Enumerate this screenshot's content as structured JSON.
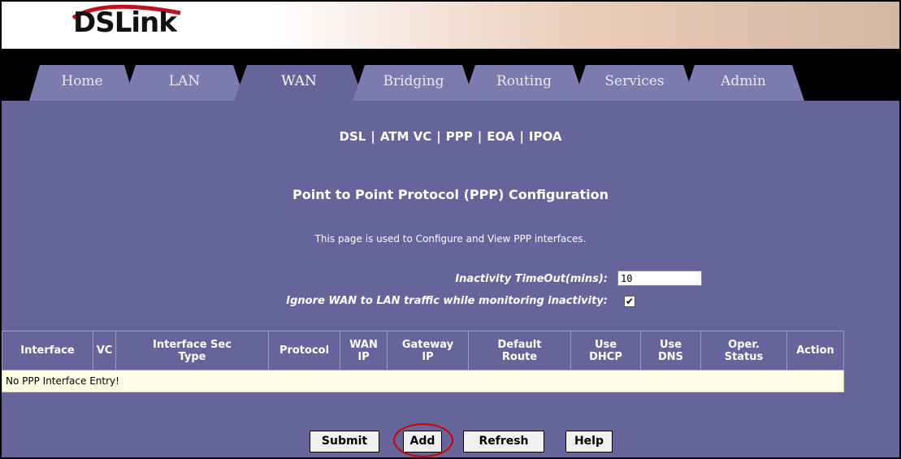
{
  "brand": {
    "logo_text": "DSLink"
  },
  "tabs": [
    {
      "label": "Home"
    },
    {
      "label": "LAN"
    },
    {
      "label": "WAN",
      "active": true
    },
    {
      "label": "Bridging"
    },
    {
      "label": "Routing"
    },
    {
      "label": "Services"
    },
    {
      "label": "Admin"
    }
  ],
  "subnav": {
    "items": [
      "DSL",
      "ATM VC",
      "PPP",
      "EOA",
      "IPOA"
    ],
    "separator": "|"
  },
  "page": {
    "title": "Point to Point Protocol (PPP) Configuration",
    "description": "This page is used to Configure and View PPP interfaces."
  },
  "form": {
    "inactivity_label": "Inactivity TimeOut(mins):",
    "inactivity_value": "10",
    "ignore_label": "Ignore WAN to LAN traffic while monitoring inactivity:",
    "ignore_checked": true
  },
  "table": {
    "columns": [
      [
        "Interface"
      ],
      [
        "VC"
      ],
      [
        "Interface Sec",
        "Type"
      ],
      [
        "Protocol"
      ],
      [
        "WAN",
        "IP"
      ],
      [
        "Gateway",
        "IP"
      ],
      [
        "Default",
        "Route"
      ],
      [
        "Use",
        "DHCP"
      ],
      [
        "Use",
        "DNS"
      ],
      [
        "Oper.",
        "Status"
      ],
      [
        "Action"
      ]
    ],
    "empty_message": "No PPP Interface Entry!"
  },
  "buttons": {
    "submit": "Submit",
    "add": "Add",
    "refresh": "Refresh",
    "help": "Help"
  },
  "colors": {
    "page_bg": "#65659b",
    "tab_bg": "#7b7bb0",
    "row_bg": "#fdfde6",
    "highlight": "#d00000"
  }
}
